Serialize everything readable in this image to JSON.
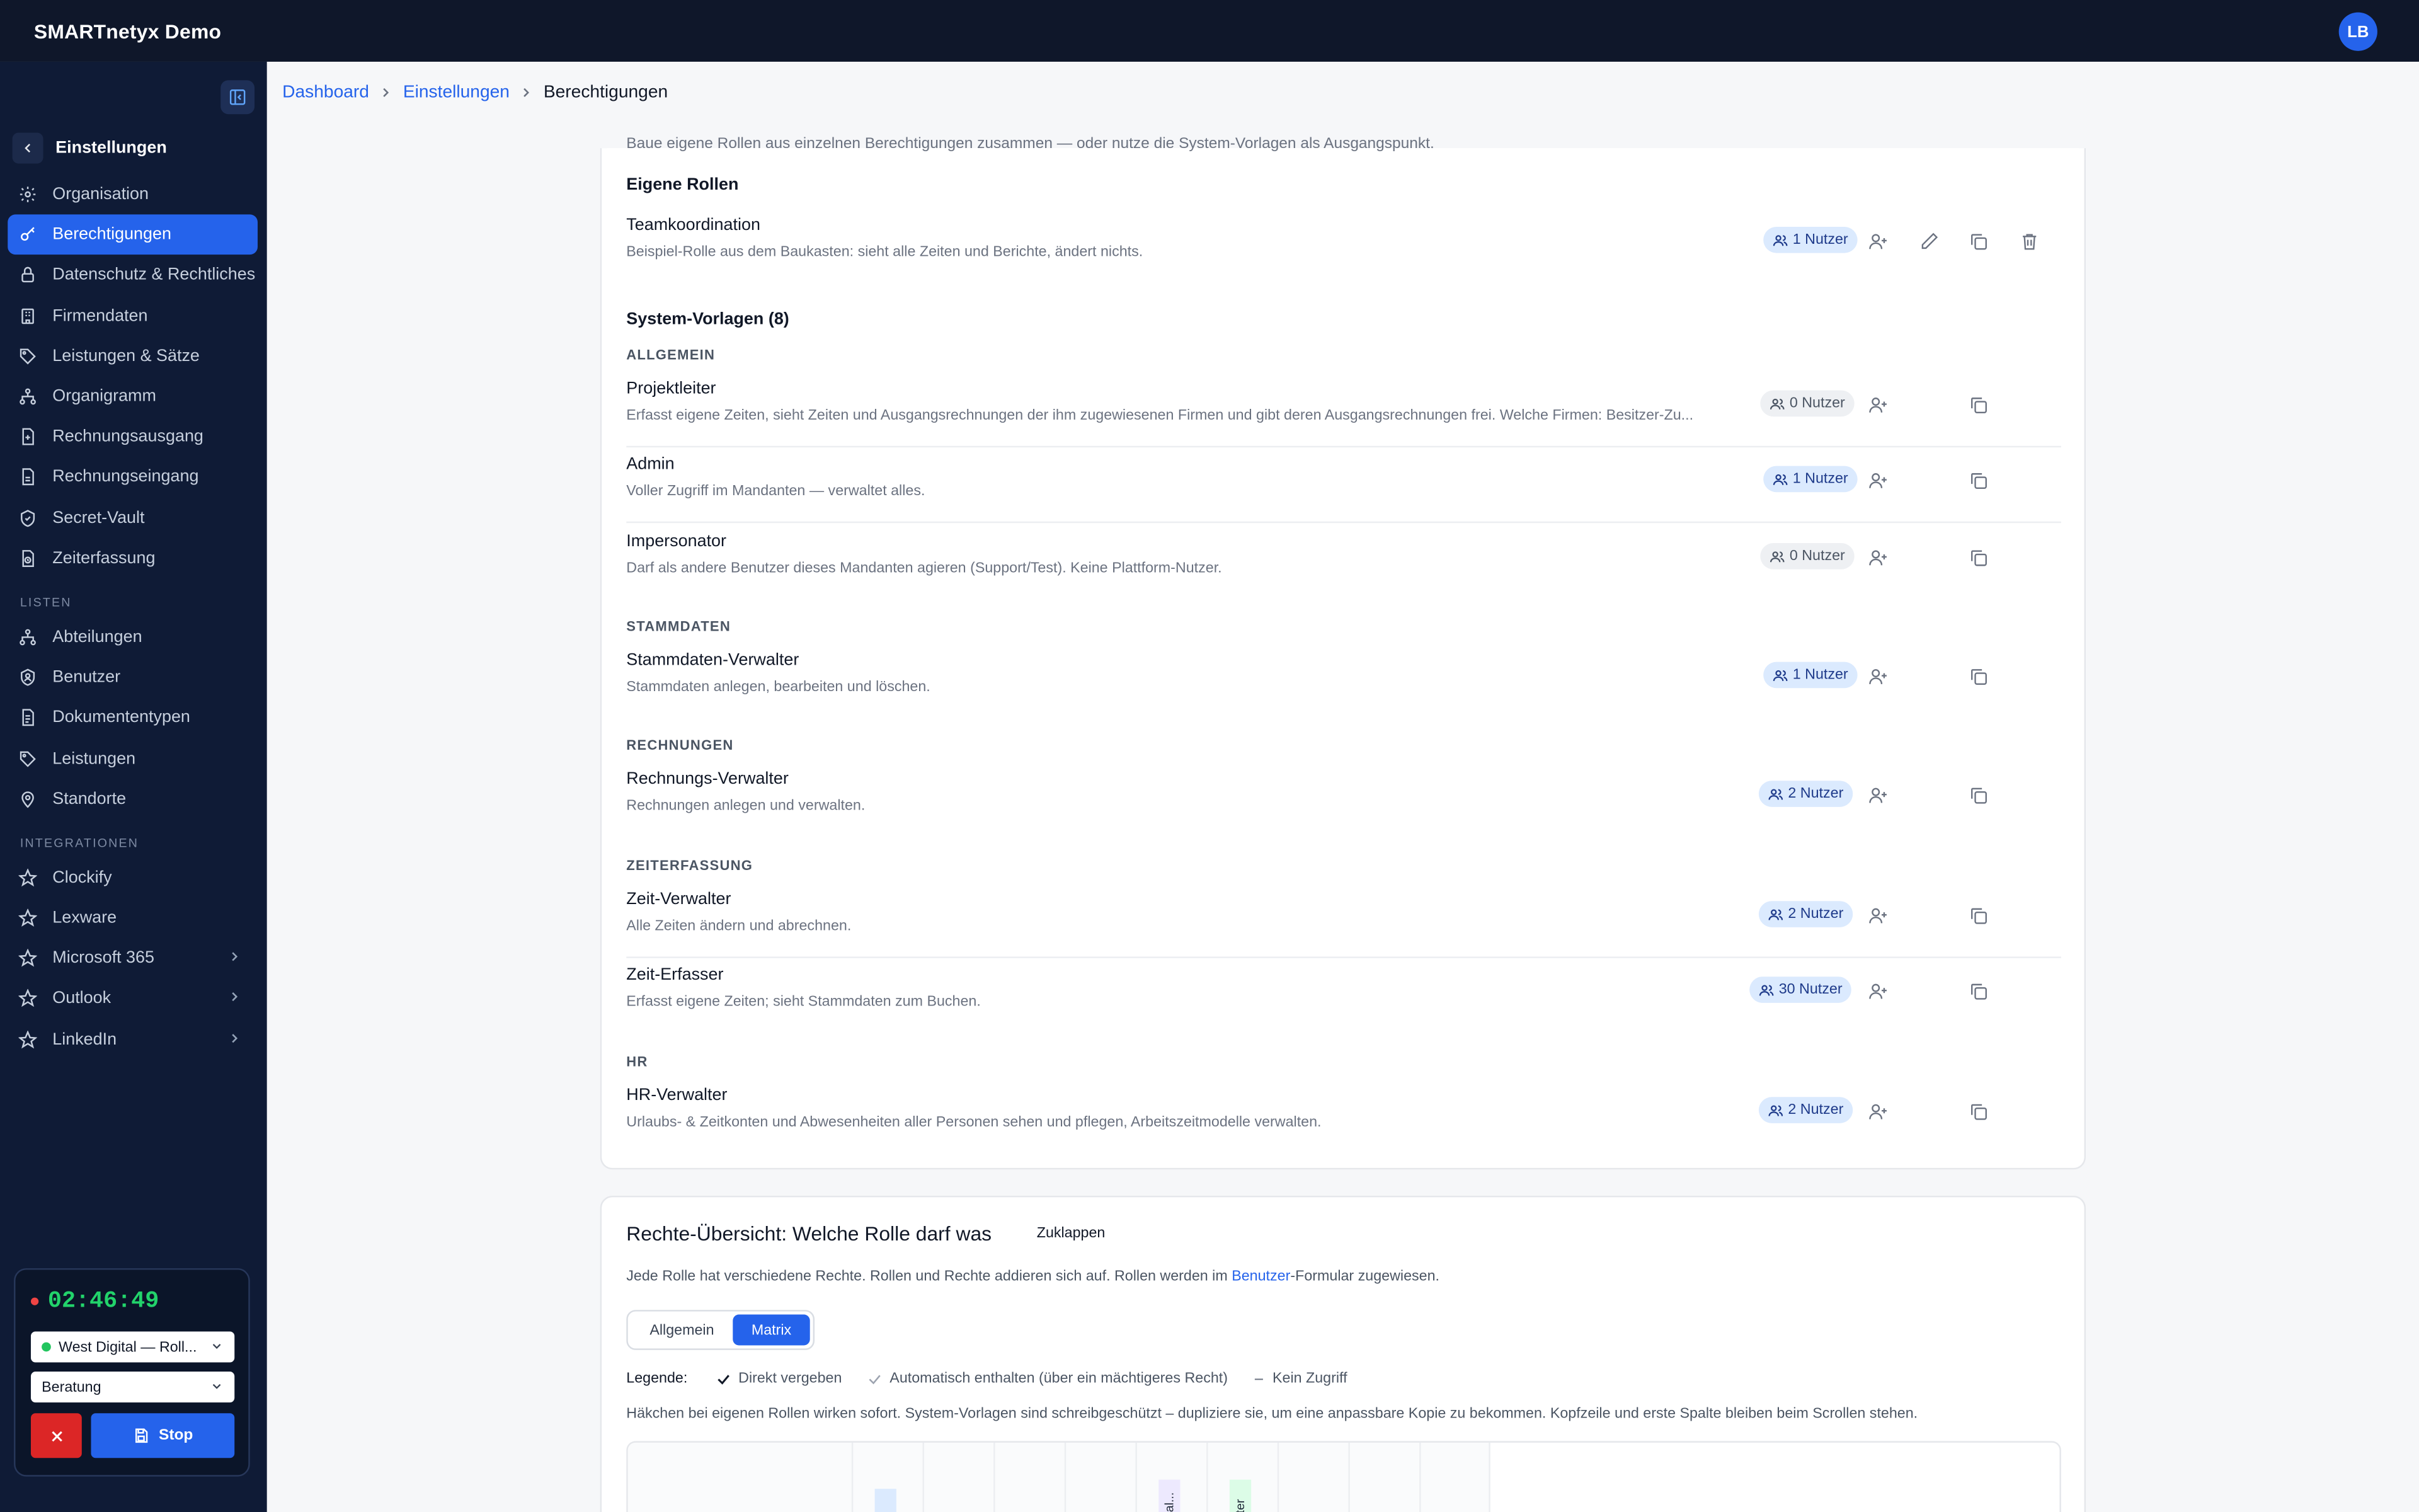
{
  "app": {
    "title": "SMARTnetyx Demo",
    "avatar_initials": "LB"
  },
  "sidebar": {
    "back_label": "Einstellungen",
    "items": [
      {
        "label": "Organisation",
        "icon": "gear-icon",
        "active": false
      },
      {
        "label": "Berechtigungen",
        "icon": "key-icon",
        "active": true
      },
      {
        "label": "Datenschutz & Rechtliches",
        "icon": "lock-icon",
        "active": false
      },
      {
        "label": "Firmendaten",
        "icon": "building-icon",
        "active": false
      },
      {
        "label": "Leistungen & Sätze",
        "icon": "tag-icon",
        "active": false
      },
      {
        "label": "Organigramm",
        "icon": "org-chart-icon",
        "active": false
      },
      {
        "label": "Rechnungsausgang",
        "icon": "invoice-out-icon",
        "active": false
      },
      {
        "label": "Rechnungseingang",
        "icon": "invoice-in-icon",
        "active": false
      },
      {
        "label": "Secret-Vault",
        "icon": "shield-icon",
        "active": false
      },
      {
        "label": "Zeiterfassung",
        "icon": "clock-doc-icon",
        "active": false
      }
    ],
    "section_lists": "LISTEN",
    "list_items": [
      {
        "label": "Abteilungen",
        "icon": "org-chart-icon"
      },
      {
        "label": "Benutzer",
        "icon": "user-shield-icon"
      },
      {
        "label": "Dokumententypen",
        "icon": "document-icon"
      },
      {
        "label": "Leistungen",
        "icon": "tag-icon"
      },
      {
        "label": "Standorte",
        "icon": "map-pin-icon"
      }
    ],
    "section_integrations": "INTEGRATIONEN",
    "integration_items": [
      {
        "label": "Clockify",
        "icon": "star-icon",
        "expandable": false
      },
      {
        "label": "Lexware",
        "icon": "star-icon",
        "expandable": false
      },
      {
        "label": "Microsoft 365",
        "icon": "star-icon",
        "expandable": true
      },
      {
        "label": "Outlook",
        "icon": "star-icon",
        "expandable": true
      },
      {
        "label": "LinkedIn",
        "icon": "star-icon",
        "expandable": true
      }
    ]
  },
  "timer": {
    "time": "02:46:49",
    "project": "West Digital — Roll...",
    "activity": "Beratung",
    "stop_label": "Stop"
  },
  "breadcrumb": [
    "Dashboard",
    "Einstellungen",
    "Berechtigungen"
  ],
  "roles_card": {
    "clipped_intro": "Baue eigene Rollen aus einzelnen Berechtigungen zusammen — oder nutze die System-Vorlagen als Ausgangspunkt.",
    "own_roles_title": "Eigene Rollen",
    "own_roles": [
      {
        "name": "Teamkoordination",
        "desc": "Beispiel-Rolle aus dem Baukasten: sieht alle Zeiten und Berichte, ändert nichts.",
        "users": "1 Nutzer",
        "active": true
      }
    ],
    "templates_title": "System-Vorlagen (8)",
    "groups": [
      {
        "label": "ALLGEMEIN",
        "roles": [
          {
            "name": "Projektleiter",
            "desc": "Erfasst eigene Zeiten, sieht Zeiten und Ausgangsrechnungen der ihm zugewiesenen Firmen und gibt deren Ausgangsrechnungen frei. Welche Firmen: Besitzer-Zu...",
            "users": "0 Nutzer",
            "active": false
          },
          {
            "name": "Admin",
            "desc": "Voller Zugriff im Mandanten — verwaltet alles.",
            "users": "1 Nutzer",
            "active": true
          },
          {
            "name": "Impersonator",
            "desc": "Darf als andere Benutzer dieses Mandanten agieren (Support/Test). Keine Plattform-Nutzer.",
            "users": "0 Nutzer",
            "active": false
          }
        ]
      },
      {
        "label": "STAMMDATEN",
        "roles": [
          {
            "name": "Stammdaten-Verwalter",
            "desc": "Stammdaten anlegen, bearbeiten und löschen.",
            "users": "1 Nutzer",
            "active": true
          }
        ]
      },
      {
        "label": "RECHNUNGEN",
        "roles": [
          {
            "name": "Rechnungs-Verwalter",
            "desc": "Rechnungen anlegen und verwalten.",
            "users": "2 Nutzer",
            "active": true
          }
        ]
      },
      {
        "label": "ZEITERFASSUNG",
        "roles": [
          {
            "name": "Zeit-Verwalter",
            "desc": "Alle Zeiten ändern und abrechnen.",
            "users": "2 Nutzer",
            "active": true
          },
          {
            "name": "Zeit-Erfasser",
            "desc": "Erfasst eigene Zeiten; sieht Stammdaten zum Buchen.",
            "users": "30 Nutzer",
            "active": true
          }
        ]
      },
      {
        "label": "HR",
        "roles": [
          {
            "name": "HR-Verwalter",
            "desc": "Urlaubs- & Zeitkonten und Abwesenheiten aller Personen sehen und pflegen, Arbeitszeitmodelle verwalten.",
            "users": "2 Nutzer",
            "active": true
          }
        ]
      }
    ]
  },
  "rights_card": {
    "title": "Rechte-Übersicht: Welche Rolle darf was",
    "collapse": "Zuklappen",
    "intro_pre": "Jede Rolle hat verschiedene Rechte. Rollen und Rechte addieren sich auf. Rollen werden im ",
    "intro_link": "Benutzer",
    "intro_post": "-Formular zugewiesen.",
    "tab_general": "Allgemein",
    "tab_matrix": "Matrix",
    "legend_title": "Legende:",
    "legend_direct": "Direkt vergeben",
    "legend_auto": "Automatisch enthalten (über ein mächtigeres Recht)",
    "legend_none": "Kein Zugriff",
    "note": "Häkchen bei eigenen Rollen wirken sofort. System-Vorlagen sind schreibgeschützt – dupliziere sie, um eine anpassbare Kopie zu bekommen. Kopfzeile und erste Spalte bleiben beim Scrollen stehen.",
    "matrix_headers": [
      "on",
      "erwal...",
      "walter"
    ],
    "colors": {
      "pill_blue": "#dbeafe",
      "pill_purple": "#ede9fe",
      "pill_green": "#dcfce7"
    }
  }
}
